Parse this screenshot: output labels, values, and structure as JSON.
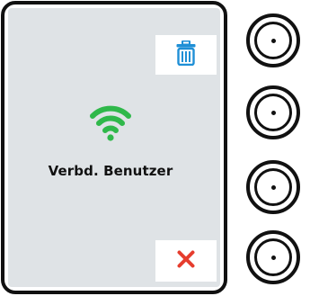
{
  "screen": {
    "status_label": "Verbd. Benutzer",
    "status_icon": "wifi-icon",
    "delete_icon": "trash-icon",
    "cancel_icon": "close-icon"
  },
  "knobs": [
    {
      "icon": "knob-1"
    },
    {
      "icon": "knob-2"
    },
    {
      "icon": "knob-3"
    },
    {
      "icon": "knob-4"
    }
  ],
  "colors": {
    "screen_bg": "#dfe3e6",
    "wifi_green": "#2fb84a",
    "trash_blue": "#1e8fd6",
    "close_red": "#e63d2e",
    "bezel": "#111111"
  }
}
